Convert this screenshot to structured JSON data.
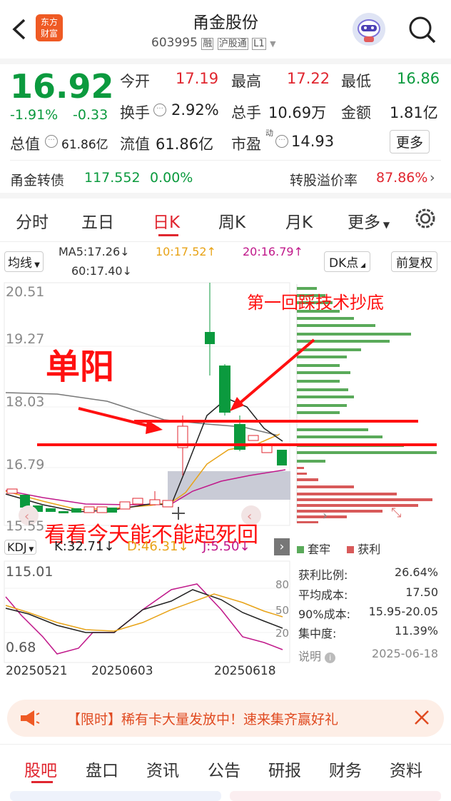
{
  "header": {
    "title": "甬金股份",
    "code": "603995",
    "tags": [
      "融",
      "沪股通",
      "L1"
    ],
    "logo_text_1": "东方",
    "logo_text_2": "财富"
  },
  "quote": {
    "price": "16.92",
    "change_pct": "-1.91%",
    "change": "-0.33",
    "open_label": "今开",
    "open": "17.19",
    "high_label": "最高",
    "high": "17.22",
    "low_label": "最低",
    "low": "16.86",
    "turnover_label": "换手",
    "turnover": "2.92%",
    "volume_label": "总手",
    "volume": "10.69万",
    "amount_label": "金额",
    "amount": "1.81亿",
    "mktcap_label": "总值",
    "mktcap": "61.86亿",
    "float_label": "流值",
    "float": "61.86亿",
    "pe_label": "市盈",
    "pe_sup": "动",
    "pe": "14.93",
    "more_label": "更多"
  },
  "bond": {
    "name": "甬金转债",
    "price": "117.552",
    "change": "0.00%",
    "premium_label": "转股溢价率",
    "premium": "87.86%"
  },
  "period_tabs": [
    "分时",
    "五日",
    "日K",
    "周K",
    "月K",
    "更多"
  ],
  "active_tab": 2,
  "ma": {
    "select": "均线",
    "ma5": "MA5:17.26↓",
    "ma10": "10:17.52↑",
    "ma20": "20:16.79↑",
    "ma60": "60:17.40↓",
    "dk": "DK点",
    "adjust": "前复权"
  },
  "price_axis": [
    "20.51",
    "19.27",
    "18.03",
    "16.79",
    "15.55"
  ],
  "annotations": {
    "danyang": "单阳",
    "first_return": "第一回踩技术抄底",
    "bottom_note": "看看今天能不能起死回"
  },
  "chip_legend": [
    "套牢",
    "获利"
  ],
  "chip_stats": [
    {
      "label": "获利比例:",
      "value": "26.64%"
    },
    {
      "label": "平均成本:",
      "value": "17.50"
    },
    {
      "label": "90%成本:",
      "value": "15.95-20.05"
    },
    {
      "label": "集中度:",
      "value": "11.39%"
    }
  ],
  "chip_note": {
    "label": "说明",
    "date": "2025-06-18"
  },
  "kdj": {
    "select": "KDJ",
    "k": "K:32.71↓",
    "d": "D:46.31↓",
    "j": "J:5.50↓",
    "axis_top": "115.01",
    "axis_bottom": "0.68",
    "levels": [
      "80",
      "50",
      "20"
    ]
  },
  "dates": [
    "20250521",
    "20250603",
    "20250618"
  ],
  "banner": "【限时】稀有卡大量发放中！速来集齐赢好礼",
  "bottom_tabs": [
    "股吧",
    "盘口",
    "资讯",
    "公告",
    "研报",
    "财务",
    "资料"
  ],
  "colors": {
    "up": "#e0262f",
    "down": "#0b9a3e",
    "ma10": "#e8a317",
    "ma20": "#c0188a"
  }
}
